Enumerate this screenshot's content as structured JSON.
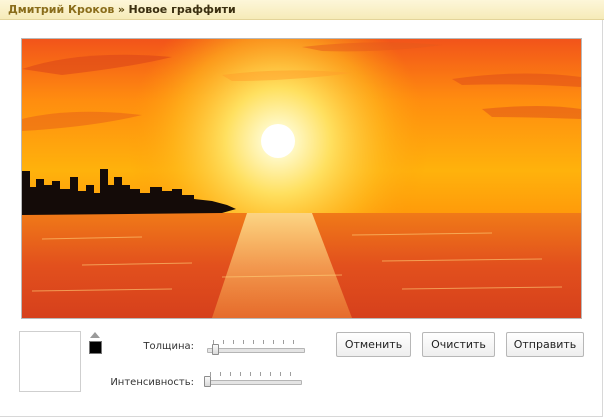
{
  "titlebar": {
    "user": "Дмитрий Кроков",
    "separator": "»",
    "page": "Новое граффити"
  },
  "canvas": {
    "content": "painted-sunset-over-sea",
    "colors": {
      "sky_top": "#ff6a1a",
      "sky_mid": "#ffb300",
      "sun_glow": "#ffe37a",
      "sun": "#ffffff",
      "sea": "#e0471b",
      "silhouette": "#120a08"
    }
  },
  "palette": {
    "current_color": "#000000",
    "swap_icon": "triangle-up-icon"
  },
  "controls": {
    "thickness_label": "Толщина:",
    "thickness_value": 0.05,
    "intensity_label": "Интенсивность:",
    "intensity_value": 0.0
  },
  "buttons": {
    "cancel": "Отменить",
    "clear": "Очистить",
    "send": "Отправить"
  }
}
